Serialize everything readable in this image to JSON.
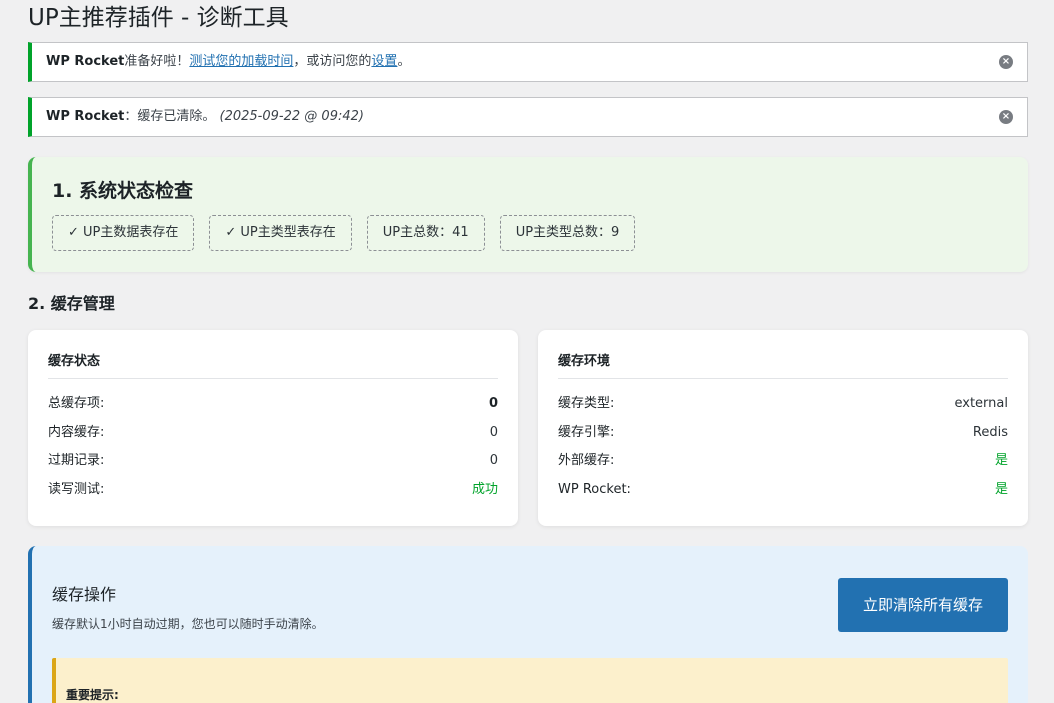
{
  "page": {
    "title": "UP主推荐插件 - 诊断工具"
  },
  "notices": [
    {
      "brand": "WP Rocket",
      "text1": "准备好啦！",
      "link1": "测试您的加载时间",
      "text2": "，或访问您的",
      "link2": "设置",
      "text3": "。"
    },
    {
      "brand": "WP Rocket",
      "text1": "：缓存已清除。",
      "time": "(2025-09-22 @ 09:42)"
    }
  ],
  "dismiss_glyph": "×",
  "system_status": {
    "title": "1. 系统状态检查",
    "pills": [
      "✓ UP主数据表存在",
      "✓ UP主类型表存在",
      "UP主总数：41",
      "UP主类型总数：9"
    ]
  },
  "cache": {
    "section_title": "2. 缓存管理",
    "status_card": {
      "title": "缓存状态",
      "rows": [
        {
          "label": "总缓存项:",
          "value": "0"
        },
        {
          "label": "内容缓存:",
          "value": "0"
        },
        {
          "label": "过期记录:",
          "value": "0"
        },
        {
          "label": "读写测试:",
          "value": "成功"
        }
      ]
    },
    "env_card": {
      "title": "缓存环境",
      "rows": [
        {
          "label": "缓存类型:",
          "value": "external"
        },
        {
          "label": "缓存引擎:",
          "value": "Redis"
        },
        {
          "label": "外部缓存:",
          "value": "是"
        },
        {
          "label": "WP Rocket:",
          "value": "是"
        }
      ]
    },
    "ops": {
      "title": "缓存操作",
      "desc": "缓存默认1小时自动过期，您也可以随时手动清除。",
      "button": "立即清除所有缓存",
      "warning_title": "重要提示:"
    }
  },
  "colors": {
    "success": "#00a32a",
    "primary": "#2271b1",
    "status_bg": "#edf7ea",
    "ops_bg": "#e5f1fb",
    "warning_bg": "#fcf0cc"
  }
}
